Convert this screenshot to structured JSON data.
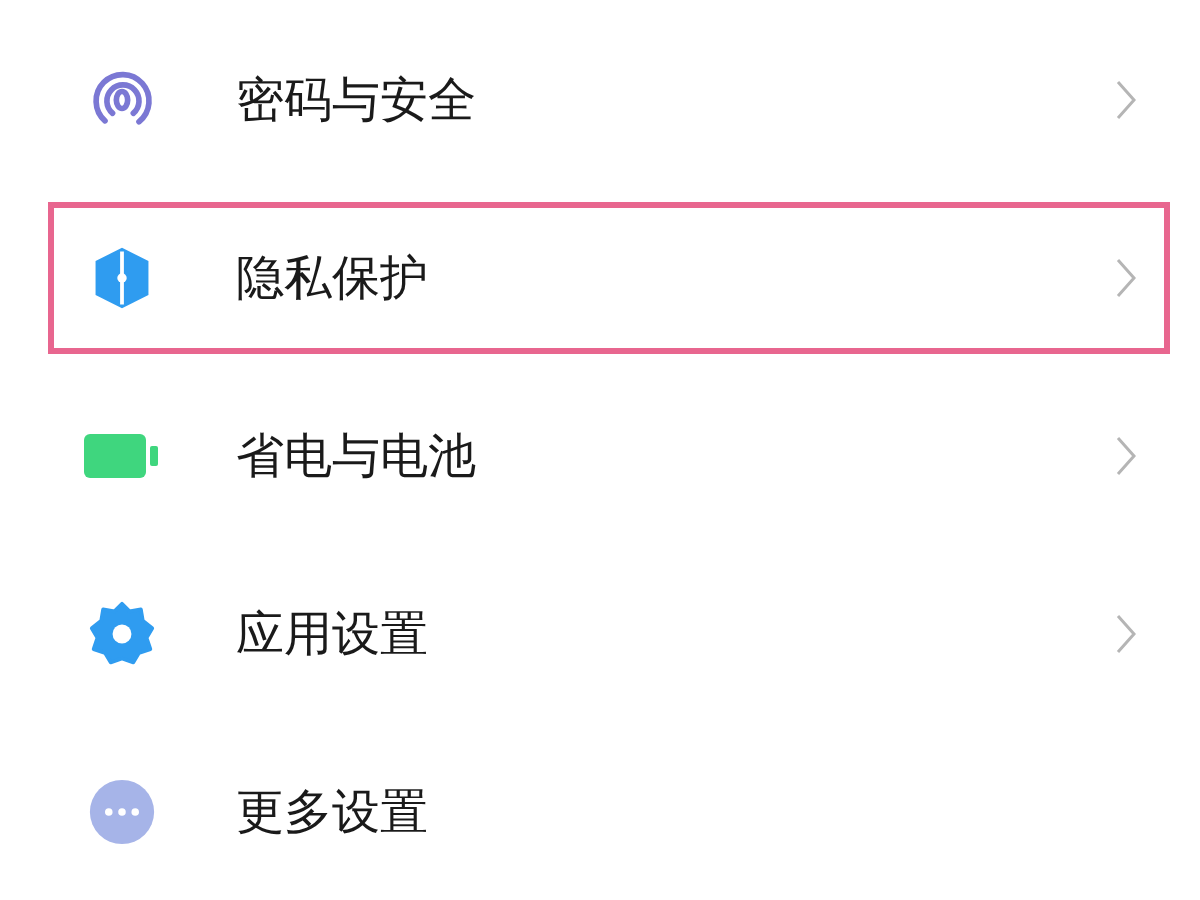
{
  "settings_items": [
    {
      "label": "密码与安全",
      "kind": "fingerprint",
      "chevron": true,
      "highlighted": false
    },
    {
      "label": "隐私保护",
      "kind": "shield",
      "chevron": true,
      "highlighted": true
    },
    {
      "label": "省电与电池",
      "kind": "battery",
      "chevron": true,
      "highlighted": false
    },
    {
      "label": "应用设置",
      "kind": "gear",
      "chevron": true,
      "highlighted": false
    },
    {
      "label": "更多设置",
      "kind": "more",
      "chevron": false,
      "highlighted": false
    }
  ]
}
